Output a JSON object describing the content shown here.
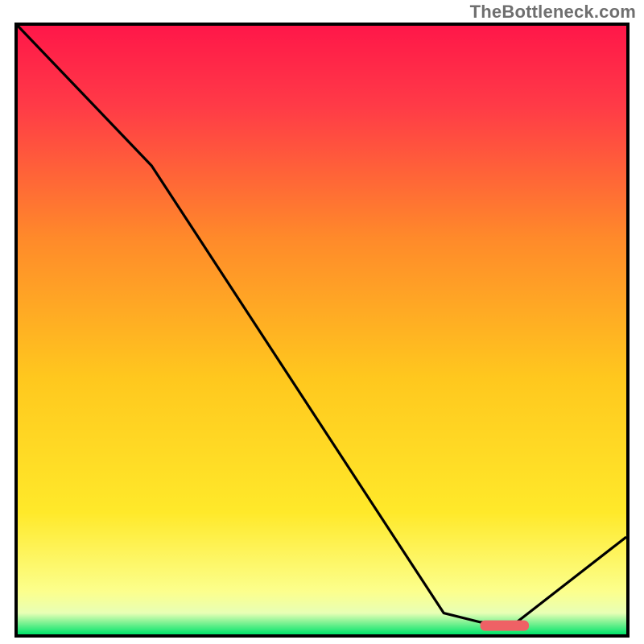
{
  "watermark": "TheBottleneck.com",
  "chart_data": {
    "type": "line",
    "title": "",
    "xlabel": "",
    "ylabel": "",
    "xlim": [
      0,
      100
    ],
    "ylim": [
      0,
      100
    ],
    "grid": false,
    "legend": false,
    "background_gradient": {
      "top_color": "#ff1749",
      "mid_color": "#ffd500",
      "bottom_band_color": "#00e36a",
      "bottom_band_fraction": 0.035
    },
    "series": [
      {
        "name": "bottleneck-curve",
        "color": "#000000",
        "x": [
          0,
          22,
          70,
          76,
          82,
          100
        ],
        "values": [
          100,
          77,
          3.5,
          2,
          2,
          16
        ]
      }
    ],
    "marker": {
      "name": "sweet-spot",
      "color": "#ef6165",
      "shape": "rounded-bar",
      "x_start": 76,
      "x_end": 84,
      "y": 1.5
    }
  }
}
